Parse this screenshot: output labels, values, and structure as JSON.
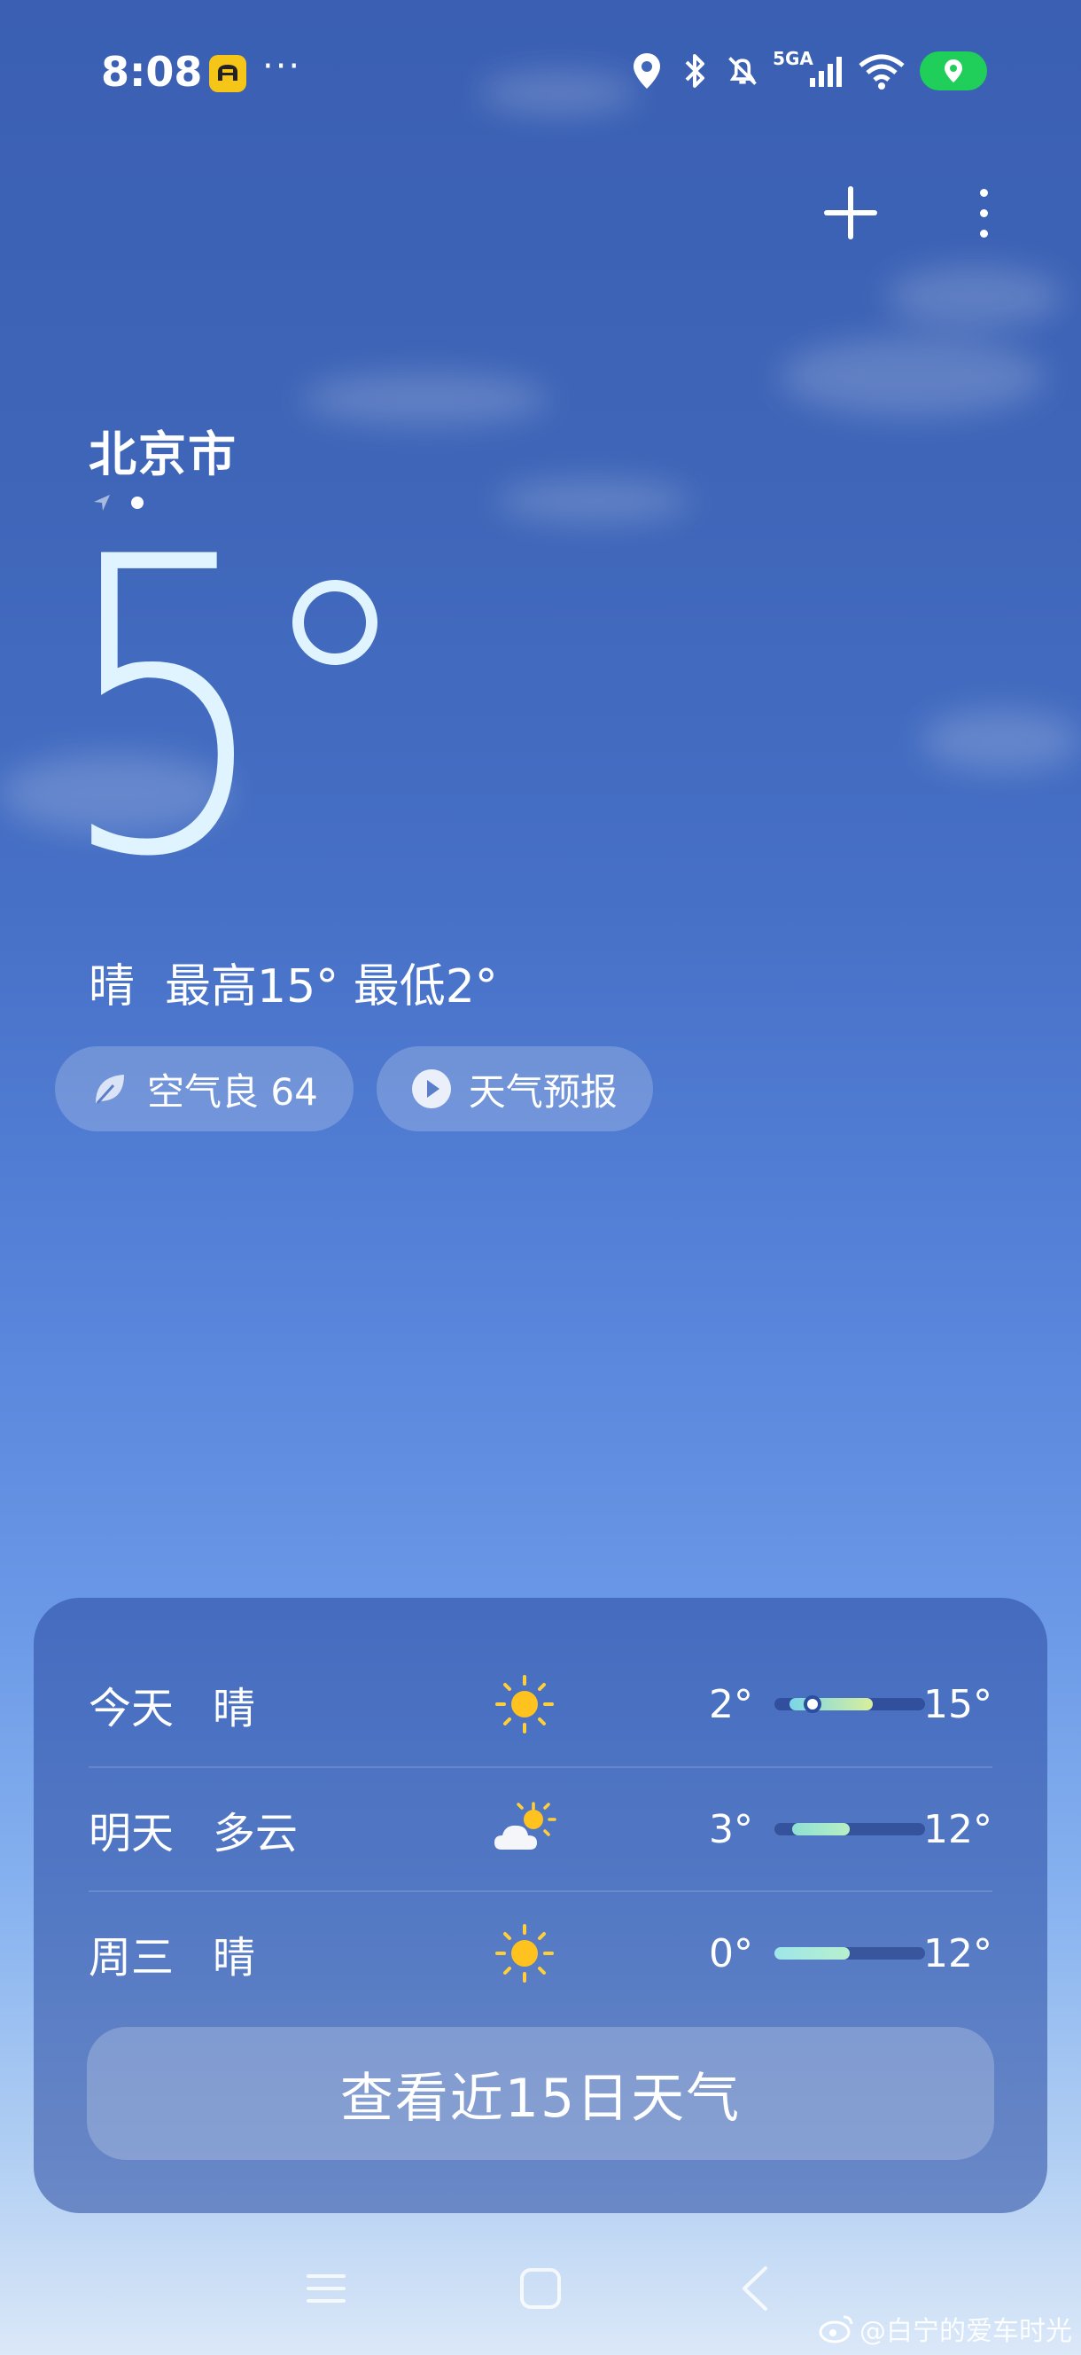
{
  "status_bar": {
    "time": "8:08",
    "more": "···",
    "network": "5GA",
    "colors": {
      "location_pill": "#1fcf5a",
      "app_badge": "#f5c518"
    }
  },
  "location": {
    "city": "北京市",
    "pages": 2,
    "current_page": 2
  },
  "current": {
    "temperature": "5",
    "degree_symbol": "°",
    "condition": "晴",
    "high_low": "最高15° 最低2°"
  },
  "chips": {
    "air": "空气良 64",
    "forecast": "天气预报"
  },
  "forecast": [
    {
      "day": "今天",
      "condition": "晴",
      "icon": "sun-icon",
      "low": "2°",
      "high": "15°",
      "range_start": 0.1,
      "range_end": 0.65,
      "now_marker": 0.25
    },
    {
      "day": "明天",
      "condition": "多云",
      "icon": "partly-cloudy-icon",
      "low": "3°",
      "high": "12°",
      "range_start": 0.12,
      "range_end": 0.5
    },
    {
      "day": "周三",
      "condition": "晴",
      "icon": "sun-icon",
      "low": "0°",
      "high": "12°",
      "range_start": 0.0,
      "range_end": 0.5
    }
  ],
  "forecast_button": "查看近15日天气",
  "watermark": "@白宁的爱车时光"
}
